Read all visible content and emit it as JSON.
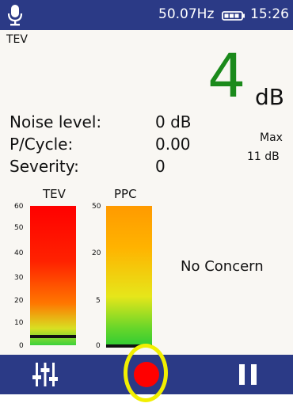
{
  "status": {
    "frequency": "50.07Hz",
    "time": "15:26"
  },
  "mode": "TEV",
  "reading": {
    "value": "4",
    "unit": "dB"
  },
  "stats": [
    {
      "label": "Noise level:",
      "value": "0 dB"
    },
    {
      "label": "P/Cycle:",
      "value": "0.00"
    },
    {
      "label": "Severity:",
      "value": "0"
    }
  ],
  "max": {
    "label": "Max",
    "value": "11 dB"
  },
  "meters": [
    {
      "title": "TEV",
      "ticks": [
        "60",
        "50",
        "40",
        "30",
        "20",
        "10",
        "0"
      ],
      "level": 4
    },
    {
      "title": "PPC",
      "ticks": [
        "50",
        "20",
        "5",
        "0"
      ],
      "level": 0
    }
  ],
  "assessment": "No Concern",
  "colors": {
    "status_bar": "#2b3a86",
    "reading": "#1b8a1b",
    "record": "#ff0000",
    "highlight_ring": "#f2ef00"
  },
  "icons": {
    "mic": "microphone-icon",
    "battery": "battery-icon",
    "settings": "sliders-icon",
    "record": "record-icon",
    "pause": "pause-icon"
  }
}
